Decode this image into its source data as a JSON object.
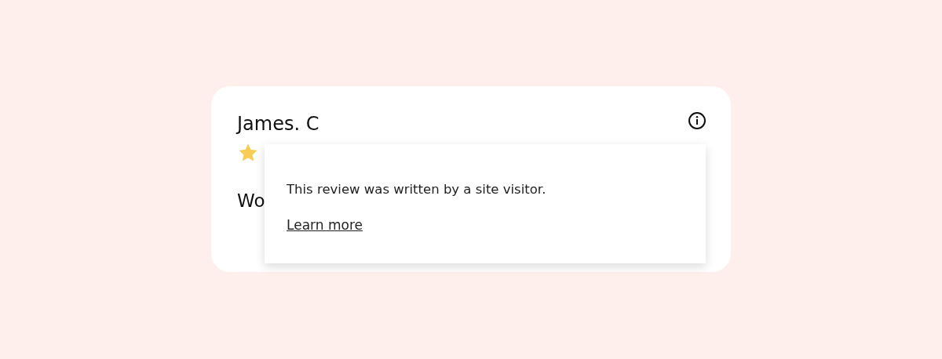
{
  "review": {
    "author": "James. C",
    "body": "Wo"
  },
  "tooltip": {
    "text": "This review was written by a site visitor.",
    "link": "Learn more"
  }
}
